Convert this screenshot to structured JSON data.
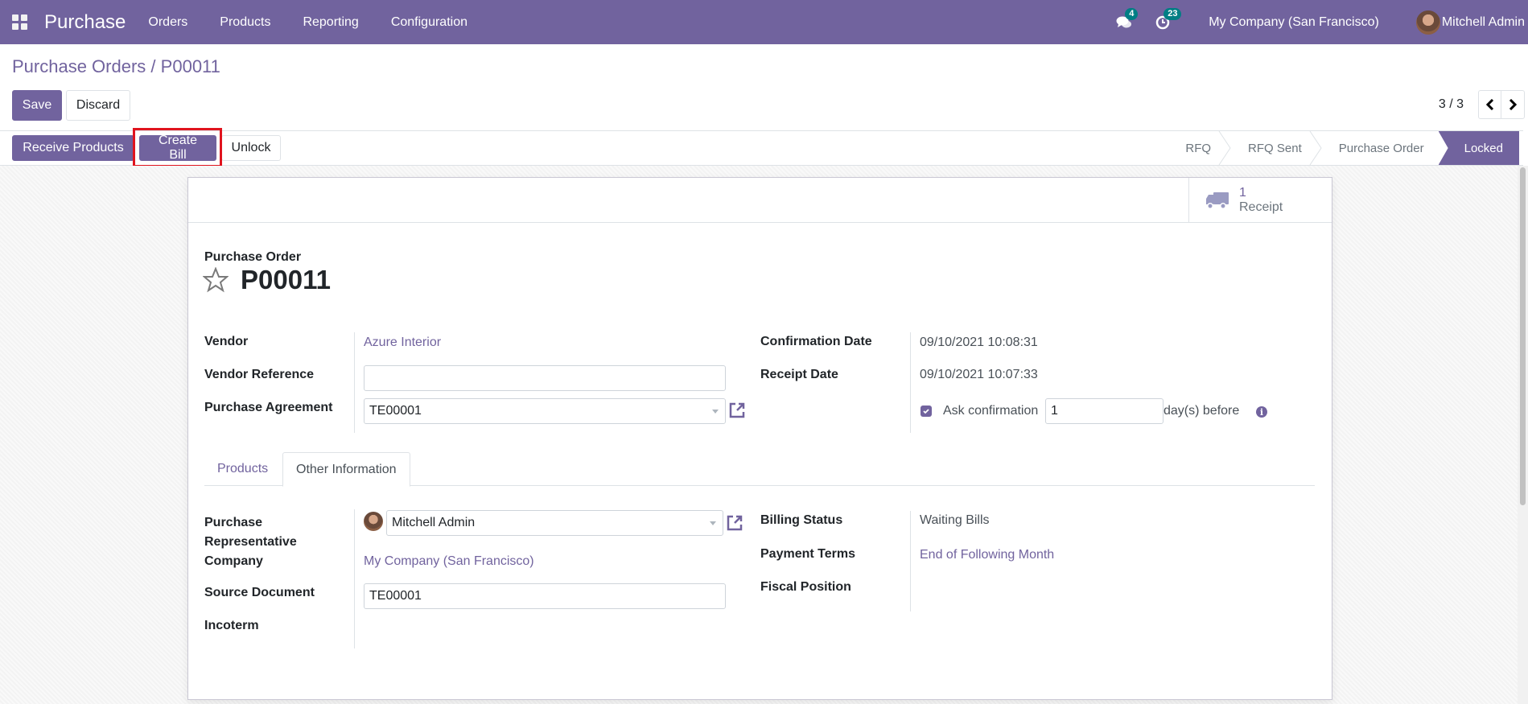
{
  "navbar": {
    "app_name": "Purchase",
    "menu": [
      "Orders",
      "Products",
      "Reporting",
      "Configuration"
    ],
    "messages_count": "4",
    "activities_count": "23",
    "company": "My Company (San Francisco)",
    "user": "Mitchell Admin",
    "icons": {
      "apps": "apps-grid-icon",
      "messages": "chat-icon",
      "activities": "clock-icon"
    }
  },
  "breadcrumb": {
    "parent": "Purchase Orders",
    "separator": "/",
    "current": "P00011"
  },
  "actions": {
    "save": "Save",
    "discard": "Discard"
  },
  "pager": {
    "value": "3 / 3",
    "prev": "‹",
    "next": "›"
  },
  "statusbar": {
    "buttons": {
      "receive": "Receive Products",
      "create_bill": "Create Bill",
      "unlock": "Unlock"
    },
    "stages": [
      "RFQ",
      "RFQ Sent",
      "Purchase Order",
      "Locked"
    ],
    "active_stage": "Locked"
  },
  "smart_button": {
    "value": "1",
    "label": "Receipt",
    "icon": "truck-icon"
  },
  "form": {
    "title_label": "Purchase Order",
    "name": "P00011",
    "left": {
      "vendor_label": "Vendor",
      "vendor": "Azure Interior",
      "vendor_ref_label": "Vendor Reference",
      "vendor_ref": "",
      "agreement_label": "Purchase Agreement",
      "agreement": "TE00001"
    },
    "right": {
      "confirmation_label": "Confirmation Date",
      "confirmation": "09/10/2021 10:08:31",
      "receipt_label": "Receipt Date",
      "receipt": "09/10/2021 10:07:33",
      "ask_confirmation_label": "Ask confirmation",
      "ask_confirmation_checked": true,
      "ask_days": "1",
      "days_suffix": "day(s) before"
    },
    "tabs": [
      "Products",
      "Other Information"
    ],
    "active_tab": "Other Information",
    "other": {
      "rep_label_1": "Purchase",
      "rep_label_2": "Representative",
      "representative": "Mitchell Admin",
      "company_label": "Company",
      "company": "My Company (San Francisco)",
      "source_label": "Source Document",
      "source": "TE00001",
      "incoterm_label": "Incoterm",
      "incoterm": "",
      "billing_label": "Billing Status",
      "billing": "Waiting Bills",
      "payment_label": "Payment Terms",
      "payment": "End of Following Month",
      "fiscal_label": "Fiscal Position",
      "fiscal": ""
    }
  }
}
